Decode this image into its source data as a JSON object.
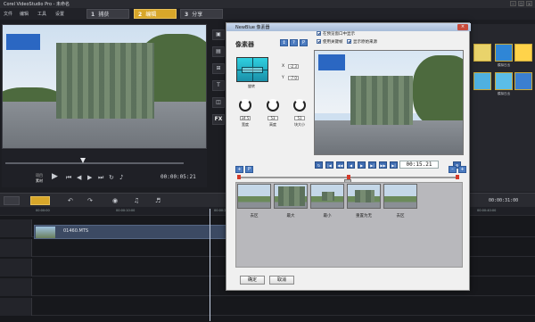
{
  "app": {
    "title": "Corel VideoStudio Pro - 未命名"
  },
  "menu": {
    "items": [
      "文件",
      "编辑",
      "工具",
      "设置"
    ]
  },
  "steps": [
    {
      "num": "1",
      "label": "捕获",
      "active": false
    },
    {
      "num": "2",
      "label": "编辑",
      "active": true
    },
    {
      "num": "3",
      "label": "分享",
      "active": false
    }
  ],
  "preview": {
    "project_label": "项目",
    "clip_label": "素材",
    "timecode": "00:00:05:21"
  },
  "library": {
    "labels": [
      "",
      "模拟日出",
      "",
      "模拟日出",
      ""
    ]
  },
  "timeline": {
    "clip_name": "01460.MTS",
    "ruler_time": "00:00:31:00",
    "ruler_marks": [
      "00:00:00",
      "00:00:10:00",
      "00:00:20:00",
      "00:00:30:00",
      "00:00:40:00"
    ]
  },
  "dialog": {
    "title": "NewBlue 像素器",
    "section_title": "像素器",
    "option_preview_window": "在预览窗口中显示",
    "option_use_keyframes": "使用关键帧",
    "option_show_original": "显示原始来源",
    "rotate_label": "旋转",
    "x_label": "X",
    "x_value": "-2.3",
    "y_label": "Y",
    "y_value": "-7.0",
    "knobs": [
      {
        "value": "34.5",
        "label": "宽度"
      },
      {
        "value": "53",
        "label": "高度"
      },
      {
        "value": "51",
        "label": "块大小"
      }
    ],
    "timecode": "00:15.21",
    "keyframes": [
      {
        "label": "去区"
      },
      {
        "label": "最大"
      },
      {
        "label": "最小"
      },
      {
        "label": "重置为无"
      },
      {
        "label": "去区"
      }
    ],
    "ok_label": "确定",
    "cancel_label": "取消"
  },
  "colors": {
    "accent": "#d8a72a",
    "dialog_bg": "#f0f0f0",
    "button_blue": "#4d7cc0",
    "clip_blue": "#3c4a63"
  }
}
